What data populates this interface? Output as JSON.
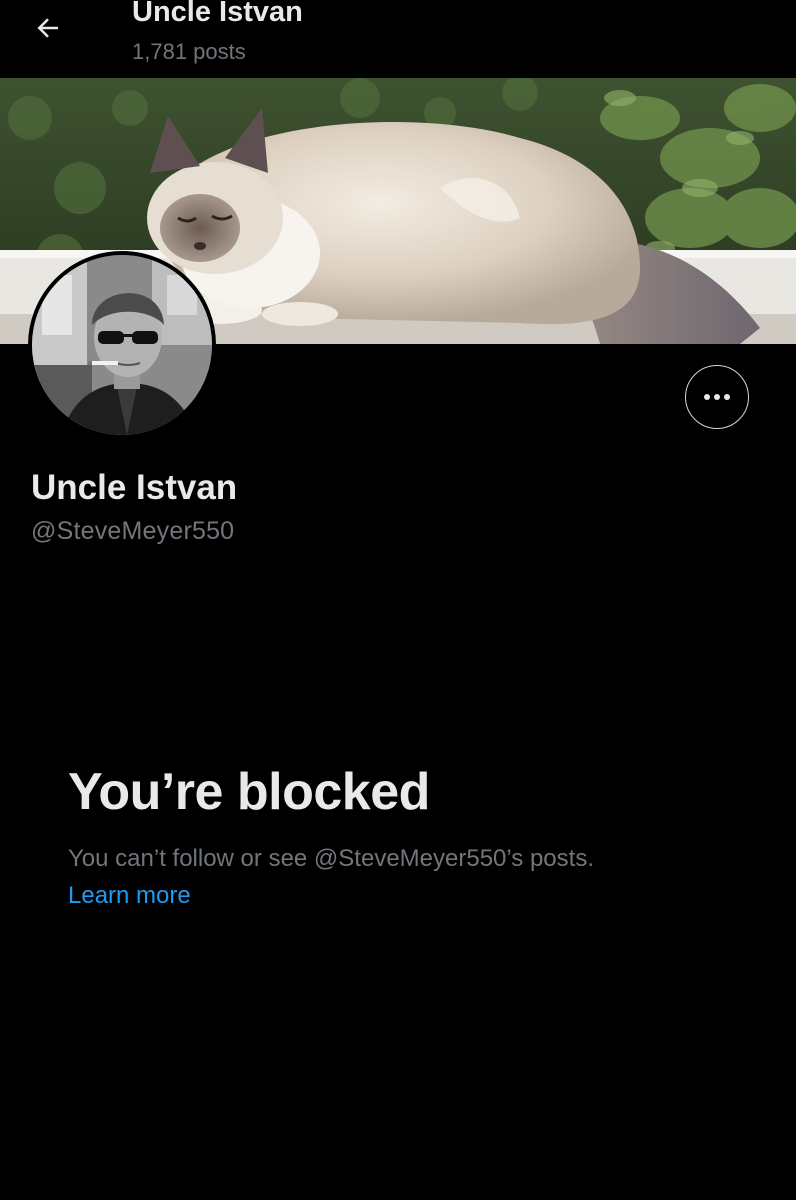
{
  "header": {
    "title": "Uncle Istvan",
    "post_count": "1,781 posts"
  },
  "icons": {
    "back": "arrow-left-icon",
    "more": "more-horizontal-icon"
  },
  "profile": {
    "display_name": "Uncle Istvan",
    "handle": "@SteveMeyer550"
  },
  "blocked": {
    "title": "You’re blocked",
    "description": "You can’t follow or see @SteveMeyer550’s posts.",
    "learn_more": "Learn more"
  },
  "colors": {
    "background": "#000000",
    "primary_text": "#e7e9ea",
    "secondary_text": "#71767b",
    "link": "#1d9bf0",
    "button_border": "#cfd9de"
  }
}
